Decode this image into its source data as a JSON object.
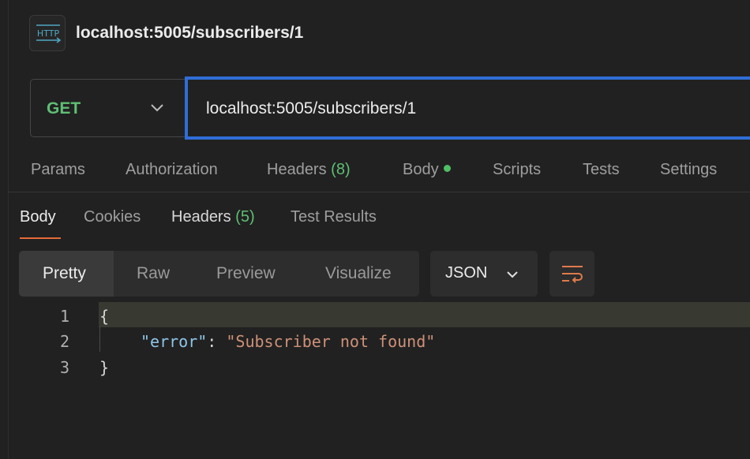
{
  "request": {
    "title": "localhost:5005/subscribers/1",
    "method": "GET",
    "url": "localhost:5005/subscribers/1"
  },
  "request_tabs": {
    "params": "Params",
    "authorization": "Authorization",
    "headers": "Headers",
    "headers_count": "(8)",
    "body": "Body",
    "scripts": "Scripts",
    "tests": "Tests",
    "settings": "Settings"
  },
  "response_tabs": {
    "body": "Body",
    "cookies": "Cookies",
    "headers": "Headers",
    "headers_count": "(5)",
    "test_results": "Test Results"
  },
  "view_modes": {
    "pretty": "Pretty",
    "raw": "Raw",
    "preview": "Preview",
    "visualize": "Visualize",
    "format": "JSON"
  },
  "code": {
    "line_numbers": [
      "1",
      "2",
      "3"
    ],
    "open_brace": "{",
    "key": "\"error\"",
    "colon": ": ",
    "value": "\"Subscriber not found\"",
    "close_brace": "}"
  },
  "icons": {
    "request_type": "http-icon",
    "method_dropdown": "chevron-down-icon",
    "format_dropdown": "chevron-down-icon",
    "wrap": "wrap-lines-icon"
  },
  "colors": {
    "accent_blue": "#2f6ed8",
    "method_green": "#5fbf74",
    "active_tab_orange": "#e56a3c",
    "json_key": "#8fc6e8",
    "json_string": "#ce9178"
  }
}
